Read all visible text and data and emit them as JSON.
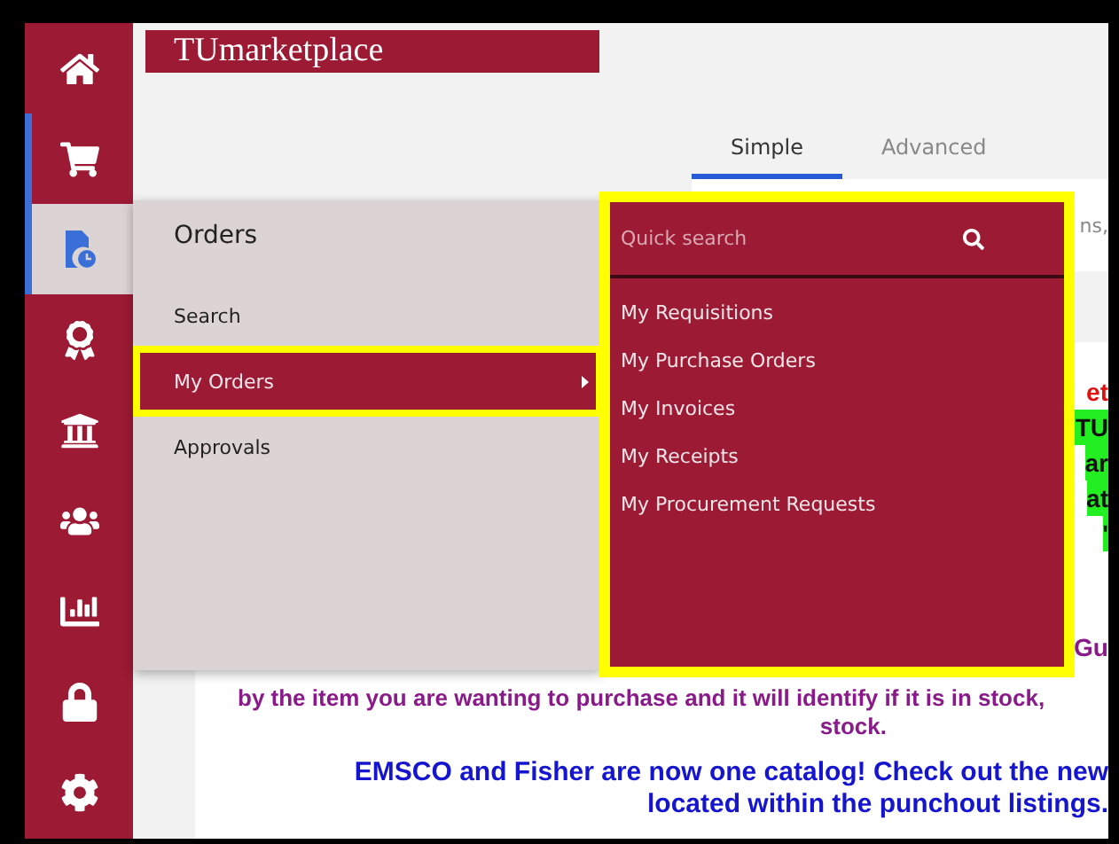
{
  "sidebar": {
    "items": [
      {
        "kind": "home",
        "selected": false,
        "marked": false
      },
      {
        "kind": "cart",
        "selected": false,
        "marked": true
      },
      {
        "kind": "orders",
        "selected": true,
        "marked": true
      },
      {
        "kind": "award",
        "selected": false,
        "marked": false
      },
      {
        "kind": "bank",
        "selected": false,
        "marked": false
      },
      {
        "kind": "users",
        "selected": false,
        "marked": false
      },
      {
        "kind": "chart",
        "selected": false,
        "marked": false
      },
      {
        "kind": "lock",
        "selected": false,
        "marked": false
      },
      {
        "kind": "settings",
        "selected": false,
        "marked": false
      }
    ]
  },
  "header": {
    "logo": "TUmarketplace"
  },
  "tabs": [
    {
      "label": "Simple",
      "selected": true
    },
    {
      "label": "Advanced",
      "selected": false
    }
  ],
  "search_panel": {
    "text": "ns,"
  },
  "content": {
    "fragments": [
      {
        "text": "et",
        "kind": "red"
      },
      {
        "text": "TU",
        "kind": "green"
      },
      {
        "text": "ar",
        "kind": "green"
      },
      {
        "text": "at",
        "kind": "green"
      },
      {
        "text": "'",
        "kind": "green"
      },
      {
        "text": "Gu",
        "kind": "purple"
      }
    ],
    "lines": [
      {
        "text": "by the item you are wanting to purchase and it will identify if it is in stock,",
        "kind": "purple"
      },
      {
        "text": "stock.",
        "kind": "purple"
      },
      {
        "text": "EMSCO and Fisher are now one catalog!  Check out the new",
        "kind": "blue"
      },
      {
        "text": "located within the punchout listings.",
        "kind": "blue"
      }
    ]
  },
  "flyout": {
    "title": "Orders",
    "items": [
      {
        "label": "Search",
        "selected": false,
        "highlighted": false
      },
      {
        "label": "My Orders",
        "selected": true,
        "highlighted": true
      },
      {
        "label": "Approvals",
        "selected": false,
        "highlighted": false
      }
    ]
  },
  "submenu": {
    "highlighted": true,
    "search": {
      "placeholder": "Quick search"
    },
    "items": [
      "My Requisitions",
      "My Purchase Orders",
      "My Invoices",
      "My Receipts",
      "My Procurement Requests"
    ]
  }
}
